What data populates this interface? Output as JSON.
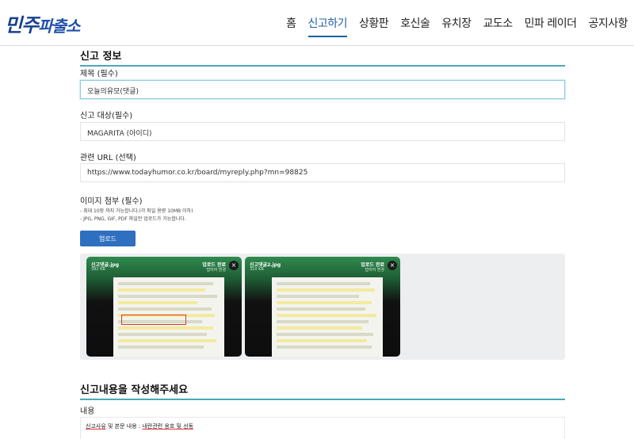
{
  "brand": {
    "logo_a": "민주",
    "logo_b": "파출소"
  },
  "nav": [
    {
      "label": "홈",
      "active": false
    },
    {
      "label": "신고하기",
      "active": true
    },
    {
      "label": "상황판",
      "active": false
    },
    {
      "label": "호신술",
      "active": false
    },
    {
      "label": "유치장",
      "active": false
    },
    {
      "label": "교도소",
      "active": false
    },
    {
      "label": "민파 레이더",
      "active": false
    },
    {
      "label": "공지사항",
      "active": false
    }
  ],
  "report_info": {
    "section_title": "신고 정보",
    "title_label": "제목 (필수)",
    "title_value": "오늘의유모(댓글)",
    "target_label": "신고 대상(필수)",
    "target_value": "MAGARITA (아이디)",
    "url_label": "관련 URL (선택)",
    "url_value": "https://www.todayhumor.co.kr/board/myreply.php?mn=98825",
    "attach_label": "이미지 첨부 (필수)",
    "help_1": "- 최대 10장 까지 가능합니다.(각 파일 용량 10MB 이하)",
    "help_2": "- JPG, PNG, GIF, PDF 파일만 업로드가 가능합니다.",
    "upload_label": "업로드"
  },
  "uploads": [
    {
      "name": "신고댓글.jpg",
      "size": "392 KB",
      "status": "업로드 완료",
      "sub": "탭하여 변경",
      "close": "×"
    },
    {
      "name": "신고댓글2.jpg",
      "size": "310 KB",
      "status": "업로드 완료",
      "sub": "탭하여 변경",
      "close": "×"
    }
  ],
  "content": {
    "section_title": "신고내용을 작성해주세요",
    "label": "내용",
    "value_a": "신고사유",
    "value_b": " 및 본문 내용 : ",
    "value_c": "내란관련 옹호 및 선동"
  },
  "colors": {
    "accent": "#49a9b8",
    "nav_active": "#1f5fa0",
    "button": "#2f6fbf",
    "logo": "#1f4fa8"
  }
}
